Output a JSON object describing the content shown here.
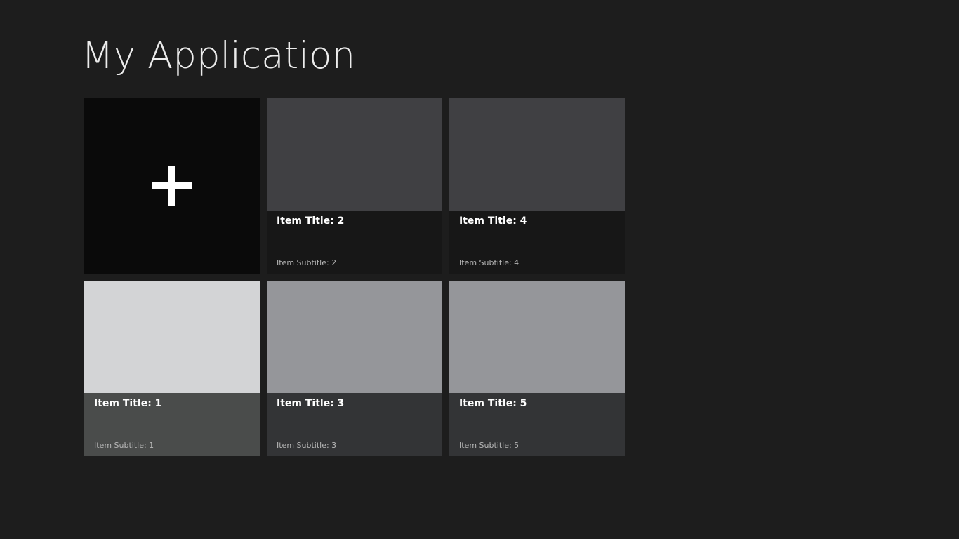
{
  "app": {
    "title": "My Application"
  },
  "add_tile": {
    "icon": "plus-icon",
    "background": "#0a0a0a"
  },
  "items": [
    {
      "title": "Item Title: 2",
      "subtitle": "Item Subtitle: 2",
      "image_color": "#404043",
      "caption_color": "#171717"
    },
    {
      "title": "Item Title: 4",
      "subtitle": "Item Subtitle: 4",
      "image_color": "#404043",
      "caption_color": "#171717"
    },
    {
      "title": "Item Title: 1",
      "subtitle": "Item Subtitle: 1",
      "image_color": "#d3d4d6",
      "caption_color": "#4a4c4b"
    },
    {
      "title": "Item Title: 3",
      "subtitle": "Item Subtitle: 3",
      "image_color": "#95969a",
      "caption_color": "#333436"
    },
    {
      "title": "Item Title: 5",
      "subtitle": "Item Subtitle: 5",
      "image_color": "#95969a",
      "caption_color": "#333436"
    }
  ],
  "colors": {
    "background": "#1d1d1d",
    "title_text": "#ececec",
    "subtitle_text": "#b6b6b6"
  }
}
